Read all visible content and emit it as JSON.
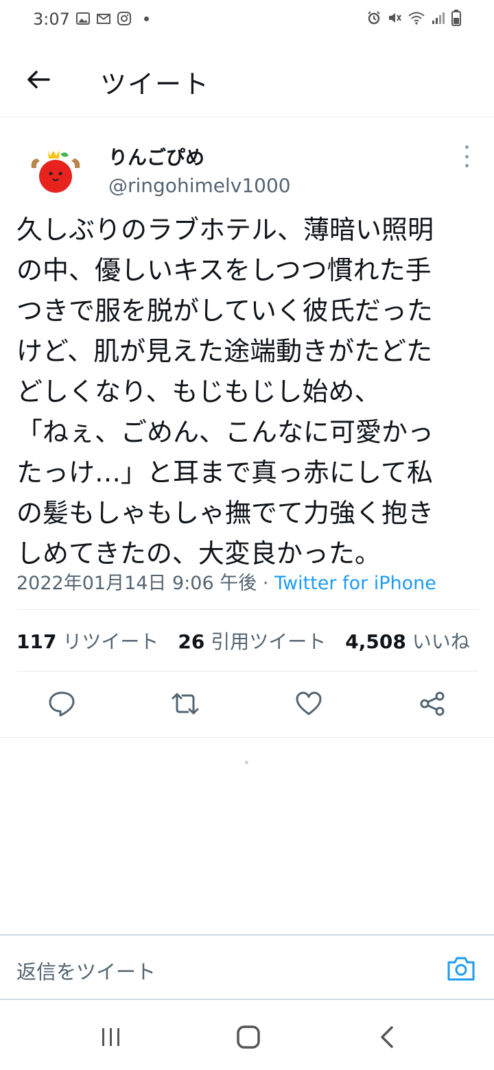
{
  "status_bar": {
    "time": "3:07",
    "left_icons": [
      "image-icon",
      "gmail-icon",
      "instagram-icon"
    ],
    "right_icons": [
      "alarm-icon",
      "mute-icon",
      "wifi-icon",
      "signal-icon",
      "battery-icon"
    ]
  },
  "header": {
    "title": "ツイート"
  },
  "tweet": {
    "display_name": "りんごぴめ",
    "handle": "@ringohimelv1000",
    "text": "久しぶりのラブホテル、薄暗い照明\nの中、優しいキスをしつつ慣れた手\nつきで服を脱がしていく彼氏だった\nけど、肌が見えた途端動きがたどた\nどしくなり、もじもじし始め、\n「ねぇ、ごめん、こんなに可愛かっ\nたっけ…」と耳まで真っ赤にして私\nの髪もしゃもしゃ撫でて力強く抱き\nしめてきたの、大変良かった。",
    "timestamp": "2022年01月14日 9:06 午後",
    "separator": " · ",
    "source": "Twitter for iPhone",
    "stats": {
      "retweets_count": "117",
      "retweets_label": "リツイート",
      "quotes_count": "26",
      "quotes_label": "引用ツイート",
      "likes_count": "4,508",
      "likes_label": "いいね"
    }
  },
  "reply": {
    "placeholder": "返信をツイート"
  },
  "colors": {
    "accent": "#1d9bf0",
    "text": "#0f1419",
    "secondary": "#536471",
    "divider": "#e6ecf0"
  }
}
